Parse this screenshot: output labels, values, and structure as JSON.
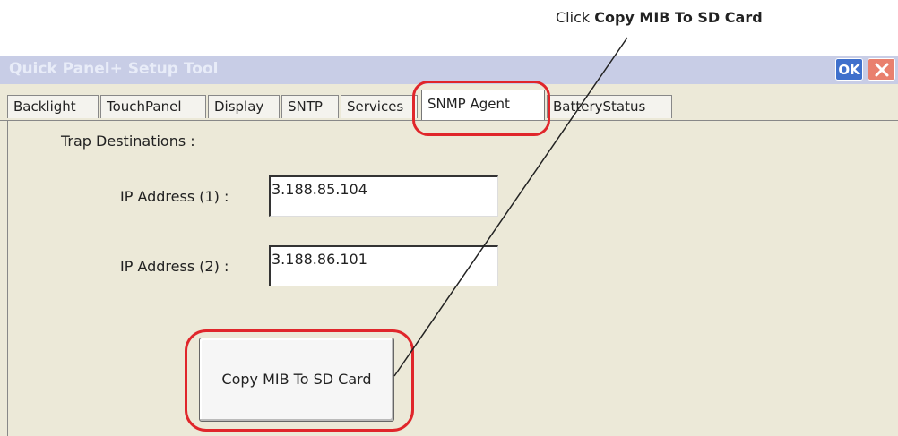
{
  "callout": {
    "prefix": "Click ",
    "bold": "Copy MIB To SD Card"
  },
  "window": {
    "title": "Quick Panel+ Setup Tool",
    "ok_label": "OK"
  },
  "tabs": [
    {
      "label": "Backlight"
    },
    {
      "label": "TouchPanel"
    },
    {
      "label": "Display"
    },
    {
      "label": "SNTP"
    },
    {
      "label": "Services"
    },
    {
      "label": "SNMP Agent",
      "active": true
    },
    {
      "label": "BatteryStatus"
    }
  ],
  "snmp": {
    "section_label": "Trap Destinations :",
    "ip1_label": "IP Address (1) :",
    "ip1_value": "3.188.85.104",
    "ip2_label": "IP Address (2) :",
    "ip2_value": "3.188.86.101",
    "copy_button_label": "Copy MIB To SD Card"
  },
  "colors": {
    "highlight": "#e0262b",
    "title_bar": "#c8cde6",
    "ok_button": "#3f70cc"
  }
}
